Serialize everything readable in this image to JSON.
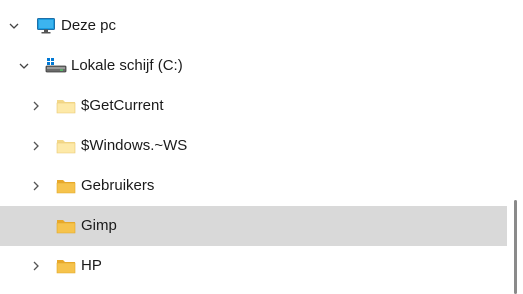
{
  "tree": {
    "items": [
      {
        "label": "Deze pc",
        "icon": "monitor-icon",
        "expander": "chevron-down-icon"
      },
      {
        "label": "Lokale schijf (C:)",
        "icon": "drive-icon",
        "expander": "chevron-down-icon"
      },
      {
        "label": "$GetCurrent",
        "icon": "folder-icon",
        "expander": "chevron-right-icon"
      },
      {
        "label": "$Windows.~WS",
        "icon": "folder-icon",
        "expander": "chevron-right-icon"
      },
      {
        "label": "Gebruikers",
        "icon": "folder-icon",
        "expander": "chevron-right-icon"
      },
      {
        "label": "Gimp",
        "icon": "folder-icon",
        "expander": "none",
        "selected": true
      },
      {
        "label": "HP",
        "icon": "folder-icon",
        "expander": "chevron-right-icon"
      }
    ]
  },
  "colors": {
    "selected_row": "#d9d9d9",
    "folder_light": "#fde9a8",
    "folder_dark": "#f6c34c",
    "monitor_blue": "#1a9de0"
  }
}
